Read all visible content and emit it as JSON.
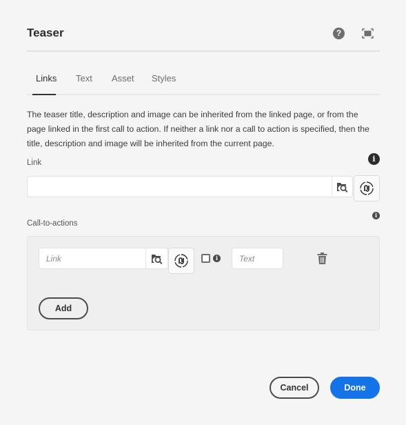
{
  "dialog": {
    "title": "Teaser",
    "help_icon": "?",
    "tabs": [
      {
        "label": "Links",
        "active": true
      },
      {
        "label": "Text",
        "active": false
      },
      {
        "label": "Asset",
        "active": false
      },
      {
        "label": "Styles",
        "active": false
      }
    ]
  },
  "links_tab": {
    "description": "The teaser title, description and image can be inherited from the linked page, or from the page linked in the first call to action. If neither a link nor a call to action is specified, then the title, description and image will be inherited from the current page.",
    "link_label": "Link",
    "link_value": "",
    "link_placeholder": "",
    "info_glyph": "i",
    "cta_label": "Call-to-actions",
    "cta_items": [
      {
        "link_placeholder": "Link",
        "link_value": "",
        "text_placeholder": "Text",
        "text_value": "",
        "checked": false
      }
    ],
    "add_label": "Add"
  },
  "footer": {
    "cancel_label": "Cancel",
    "done_label": "Done"
  },
  "colors": {
    "accent": "#1473e6",
    "background": "#f5f5f5"
  }
}
